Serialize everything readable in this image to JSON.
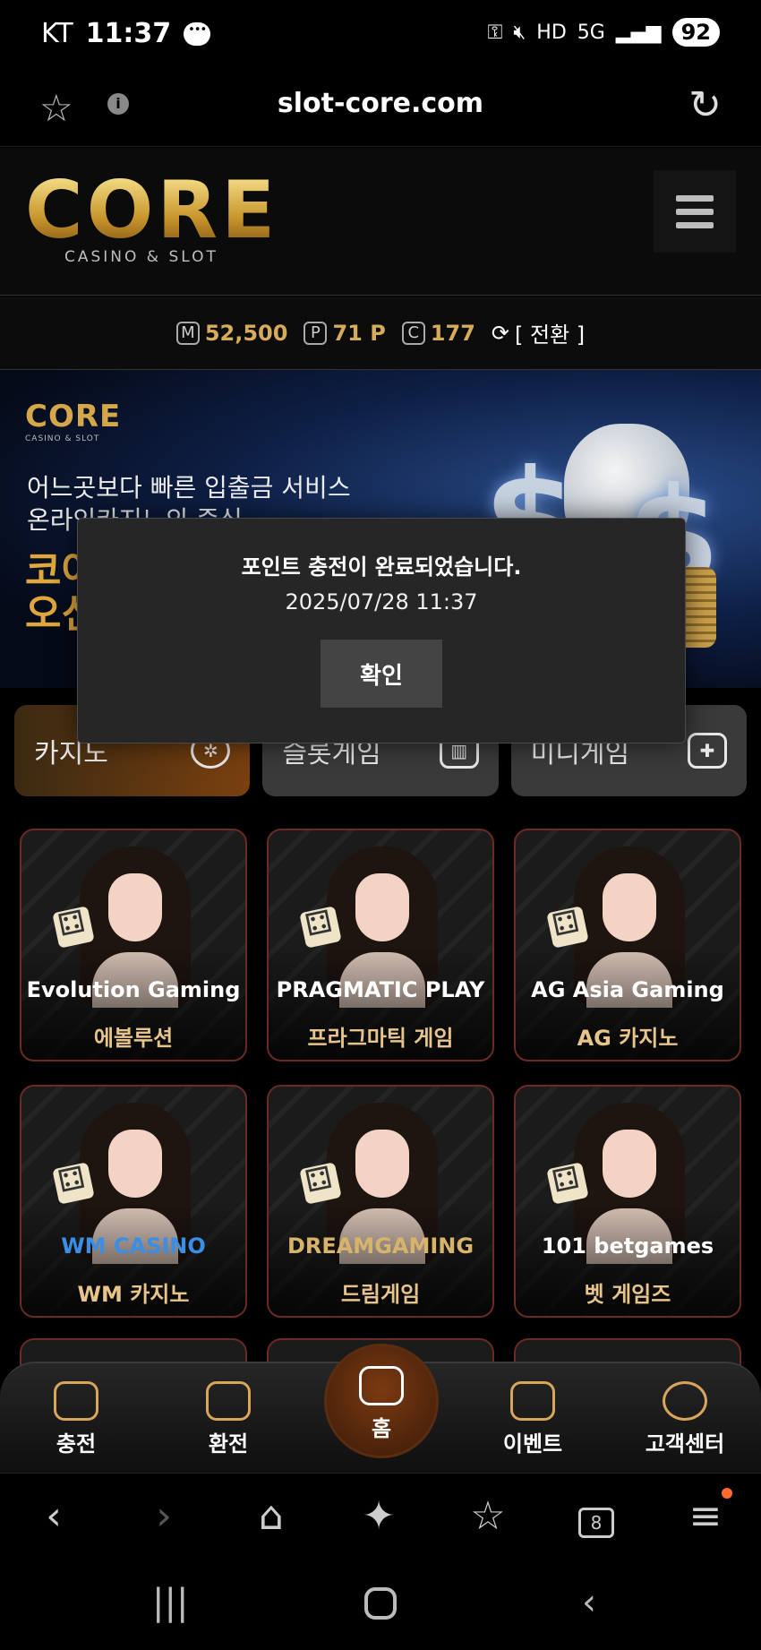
{
  "status_bar": {
    "carrier": "KT",
    "time": "11:37",
    "battery": "92"
  },
  "browser": {
    "url": "slot-core.com",
    "tab_count": "8"
  },
  "header": {
    "logo": "CORE",
    "logo_sub": "CASINO & SLOT"
  },
  "balance": {
    "money_badge": "M",
    "money": "52,500",
    "point_badge": "P",
    "point": "71 P",
    "coin_badge": "C",
    "coin": "177",
    "switch_label": "[ 전환 ]"
  },
  "banner": {
    "logo": "CORE",
    "logo_sub": "CASINO & SLOT",
    "line1": "어느곳보다 빠른 입출금 서비스",
    "line2": "온라인카지노의 중심",
    "big1": "코어",
    "big2": "오신"
  },
  "categories": [
    {
      "label": "카지노"
    },
    {
      "label": "슬롯게임"
    },
    {
      "label": "미니게임"
    }
  ],
  "games": [
    {
      "brand": "Evolution Gaming",
      "name": "에볼루션"
    },
    {
      "brand": "PRAGMATIC PLAY",
      "name": "프라그마틱 게임"
    },
    {
      "brand": "AG Asia Gaming",
      "name": "AG 카지노"
    },
    {
      "brand": "WM CASINO",
      "name": "WM 카지노"
    },
    {
      "brand": "DREAMGAMING",
      "name": "드림게임"
    },
    {
      "brand": "101 betgames",
      "name": "벳 게임즈"
    }
  ],
  "site_nav": {
    "charge": "충전",
    "exchange": "환전",
    "home": "홈",
    "event": "이벤트",
    "support": "고객센터"
  },
  "modal": {
    "message": "포인트 충전이 완료되었습니다.",
    "timestamp": "2025/07/28 11:37",
    "confirm": "확인"
  },
  "colors": {
    "accent_gold": "#d6ac5a",
    "modal_bg": "#272627"
  }
}
